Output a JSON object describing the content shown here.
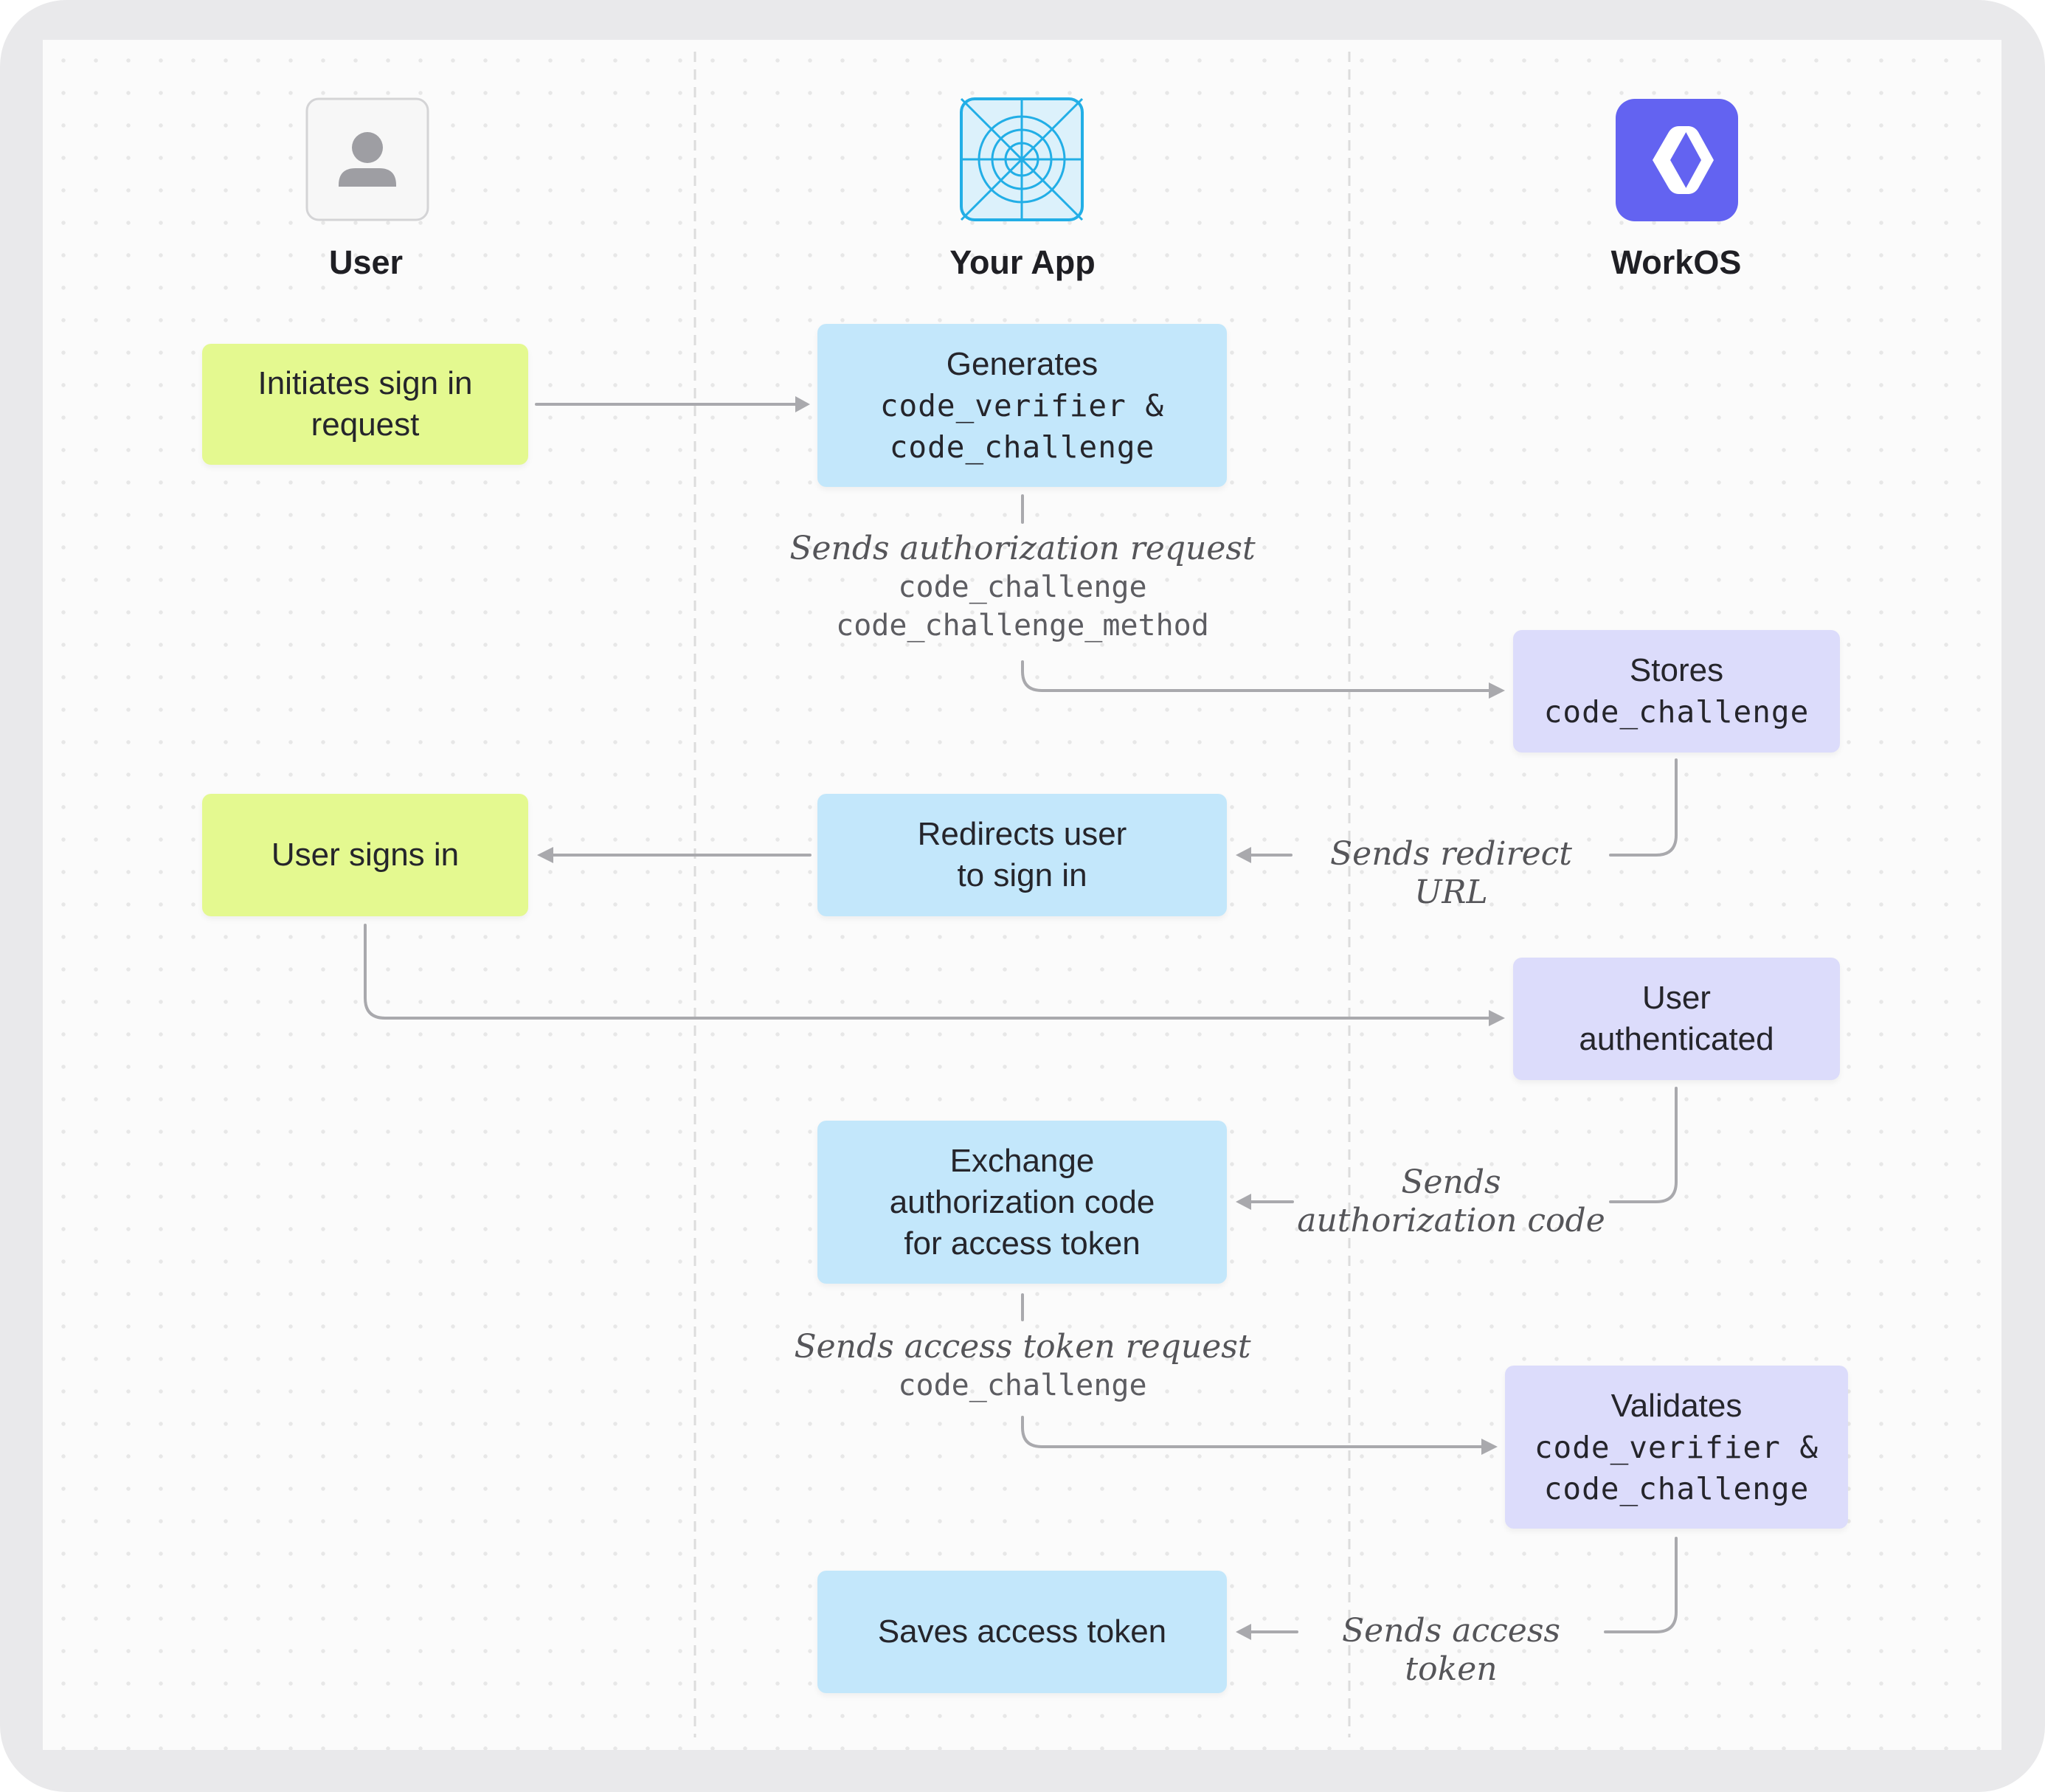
{
  "columns": {
    "user": {
      "title": "User",
      "icon": "user-avatar-icon"
    },
    "app": {
      "title": "Your App",
      "icon": "app-wheel-icon"
    },
    "workos": {
      "title": "WorkOS",
      "icon": "workos-logo-icon"
    }
  },
  "nodes": {
    "initiates": {
      "line1": "Initiates sign in",
      "line2": "request"
    },
    "generates": {
      "line1": "Generates",
      "line2": "code_verifier &",
      "line3": "code_challenge"
    },
    "stores": {
      "line1": "Stores",
      "line2": "code_challenge"
    },
    "user_signs_in": {
      "line1": "User signs in"
    },
    "redirects": {
      "line1": "Redirects user",
      "line2": "to sign in"
    },
    "user_authenticated": {
      "line1": "User",
      "line2": "authenticated"
    },
    "exchange": {
      "line1": "Exchange",
      "line2": "authorization code",
      "line3": "for access token"
    },
    "validates": {
      "line1": "Validates",
      "line2": "code_verifier &",
      "line3": "code_challenge"
    },
    "saves": {
      "line1": "Saves access token"
    }
  },
  "labels": {
    "auth_request": {
      "title": "Sends authorization request",
      "param1": "code_challenge",
      "param2": "code_challenge_method"
    },
    "redirect_url": {
      "title": "Sends redirect URL"
    },
    "auth_code": {
      "line1": "Sends",
      "line2": "authorization code"
    },
    "token_request": {
      "title": "Sends access token request",
      "param1": "code_challenge"
    },
    "access_token": {
      "title": "Sends access token"
    }
  },
  "colors": {
    "user_nodes": "#e4f990",
    "app_nodes": "#c3e7fb",
    "workos_nodes": "#dcdcfb",
    "workos_brand": "#6363f1",
    "app_icon": "#22aee6",
    "connector": "#a9a9ad"
  }
}
